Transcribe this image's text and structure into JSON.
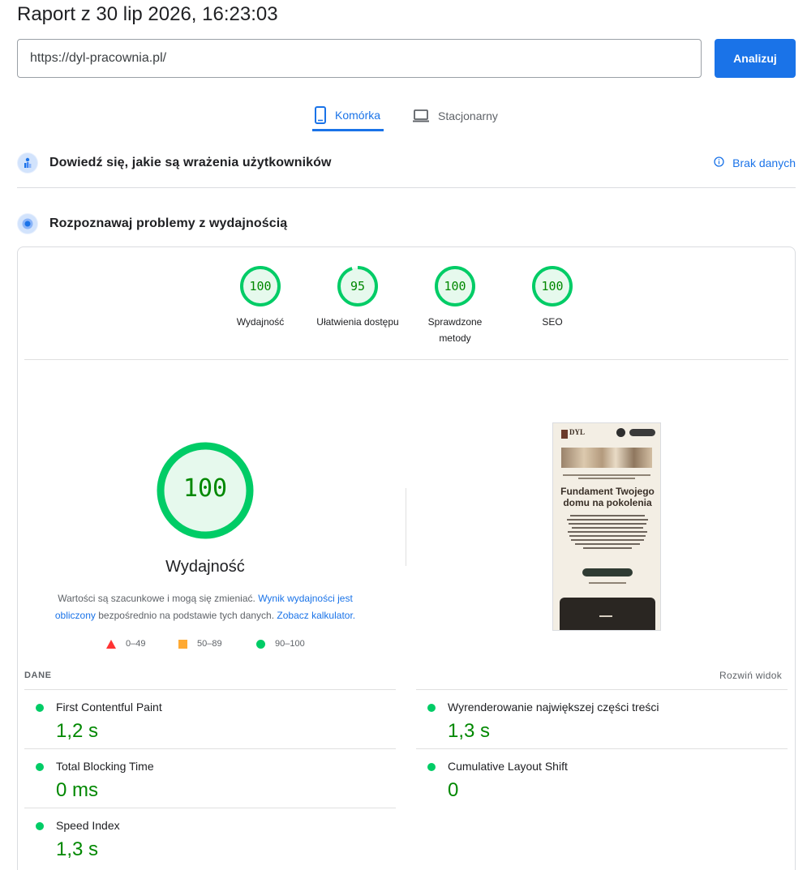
{
  "report": {
    "title": "Raport z 30 lip 2026, 16:23:03"
  },
  "url_bar": {
    "value": "https://dyl-pracownia.pl/",
    "analyze_label": "Analizuj"
  },
  "tabs": [
    {
      "label": "Komórka",
      "icon": "smartphone-icon",
      "active": true
    },
    {
      "label": "Stacjonarny",
      "icon": "laptop-icon",
      "active": false
    }
  ],
  "sections": {
    "field_data": {
      "title": "Dowiedź się, jakie są wrażenia użytkowników",
      "status": "Brak danych"
    },
    "lab_data": {
      "title": "Rozpoznawaj problemy z wydajnością"
    }
  },
  "scores": [
    {
      "label": "Wydajność",
      "value": 100
    },
    {
      "label": "Ułatwienia dostępu",
      "value": 95
    },
    {
      "label": "Sprawdzone metody",
      "value": 100
    },
    {
      "label": "SEO",
      "value": 100
    }
  ],
  "performance": {
    "score": "100",
    "label": "Wydajność",
    "note_prefix": "Wartości są szacunkowe i mogą się zmieniać.",
    "note_link1": "Wynik wydajności jest obliczony",
    "note_middle": "bezpośrednio na podstawie tych danych.",
    "note_link2": "Zobacz kalkulator."
  },
  "legend": [
    {
      "shape": "triangle",
      "range": "0–49",
      "color": "#ff3333"
    },
    {
      "shape": "square",
      "range": "50–89",
      "color": "#ffaa33"
    },
    {
      "shape": "circle",
      "range": "90–100",
      "color": "#00cc66"
    }
  ],
  "screenshot": {
    "logo_text": "DYL",
    "headline_line1": "Fundament Twojego",
    "headline_line2": "domu na pokolenia"
  },
  "metrics_header": {
    "label": "DANE",
    "expand_label": "Rozwiń widok"
  },
  "metrics": [
    {
      "name": "First Contentful Paint",
      "value": "1,2 s"
    },
    {
      "name": "Wyrenderowanie największej części treści",
      "value": "1,3 s"
    },
    {
      "name": "Total Blocking Time",
      "value": "0 ms"
    },
    {
      "name": "Cumulative Layout Shift",
      "value": "0"
    },
    {
      "name": "Speed Index",
      "value": "1,3 s"
    }
  ],
  "colors": {
    "accent": "#1a73e8",
    "pass": "#00cc66",
    "pass_text": "#008800"
  }
}
